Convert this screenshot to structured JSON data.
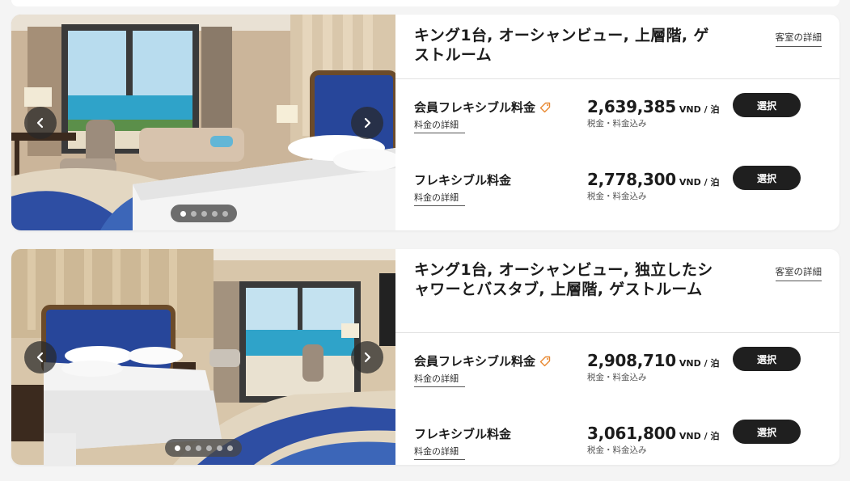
{
  "rooms": [
    {
      "title": "キング1台, オーシャンビュー, 上層階, ゲストルーム",
      "detail_link": "客室の詳細",
      "photo_dots_total": 5,
      "photo_dots_active": 1,
      "rates": [
        {
          "name": "会員フレキシブル料金",
          "has_tag_icon": true,
          "details_link": "料金の詳細",
          "price": "2,639,385",
          "unit": "VND / 泊",
          "note": "税金・料金込み",
          "button": "選択"
        },
        {
          "name": "フレキシブル料金",
          "has_tag_icon": false,
          "details_link": "料金の詳細",
          "price": "2,778,300",
          "unit": "VND / 泊",
          "note": "税金・料金込み",
          "button": "選択"
        }
      ]
    },
    {
      "title": "キング1台, オーシャンビュー, 独立したシャワーとバスタブ, 上層階, ゲストルーム",
      "detail_link": "客室の詳細",
      "photo_dots_total": 6,
      "photo_dots_active": 1,
      "rates": [
        {
          "name": "会員フレキシブル料金",
          "has_tag_icon": true,
          "details_link": "料金の詳細",
          "price": "2,908,710",
          "unit": "VND / 泊",
          "note": "税金・料金込み",
          "button": "選択"
        },
        {
          "name": "フレキシブル料金",
          "has_tag_icon": false,
          "details_link": "料金の詳細",
          "price": "3,061,800",
          "unit": "VND / 泊",
          "note": "税金・料金込み",
          "button": "選択"
        }
      ]
    }
  ],
  "icons": {
    "prev": "chevron-left-icon",
    "next": "chevron-right-icon",
    "tag": "tag-icon"
  },
  "colors": {
    "button_bg": "#1f1f1f",
    "tag_icon": "#e8872f",
    "headboard_blue": "#27469a",
    "sea": "#2fa3c9"
  }
}
